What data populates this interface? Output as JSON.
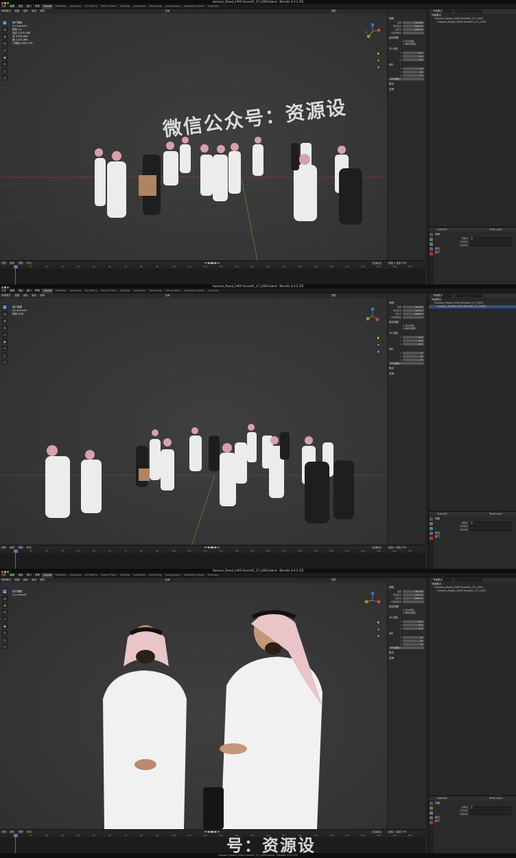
{
  "window": {
    "title_1": "Humans_Posed_2495-Scene01_27_LODS.blend - Blender 4.0.2 LTS",
    "title_2": "Humans_Posed_2495-Scene01_27_LODS.blend - Blender 4.0.2 LTS",
    "title_3": "Humans_Posed_2495-Scene01_27_LODS.blend - Blender 4.0.2 LTS"
  },
  "menubar": {
    "items": [
      "文件",
      "编辑",
      "渲染",
      "窗口",
      "帮助"
    ],
    "workspaces": [
      "Layout",
      "Modeling",
      "Sculpting",
      "UV Editing",
      "Texture Paint",
      "Shading",
      "Animation",
      "Rendering",
      "Compositing",
      "Geometry Nodes",
      "Scripting"
    ]
  },
  "viewport_header": {
    "items": [
      "物体模式",
      "视图",
      "选择",
      "添加",
      "物体"
    ],
    "right_items": [
      "全局",
      "选项"
    ]
  },
  "stats": {
    "lines_1": [
      "用户透视",
      "(1) Scene01",
      "物体  1/1",
      "顶点  2,025,388",
      "边  4,049,568",
      "面  2,025,388",
      "三角面  4,050,776"
    ],
    "lines_2": [
      "用户透视",
      "(1) Scene01",
      "物体  0/28"
    ],
    "lines_3": [
      "用户透视",
      "(1) Scene01"
    ]
  },
  "npanel": {
    "sections": [
      "变换",
      "视图",
      "3D 游标",
      "集合"
    ],
    "fields": [
      {
        "label": "焦距",
        "value": "50 mm"
      },
      {
        "label": "裁剪起点",
        "value": "0.01 m"
      },
      {
        "label": "结束点",
        "value": "1000 m"
      }
    ],
    "local_camera": "局部摄像机",
    "lock_label": "锁定视图",
    "checks": [
      "至3D游标",
      "相机到视图"
    ],
    "cursor_fields": [
      {
        "label": "X",
        "value": "0 m"
      },
      {
        "label": "Y",
        "value": "0 m"
      },
      {
        "label": "Z",
        "value": "0 m"
      }
    ],
    "rotation_label": "旋转",
    "rot_fields": [
      {
        "label": "X",
        "value": "0°"
      },
      {
        "label": "Y",
        "value": "0°"
      },
      {
        "label": "Z",
        "value": "0°"
      }
    ],
    "mode": "XYZ 欧拉"
  },
  "timeline": {
    "items": [
      "回放",
      "键控",
      "视图",
      "标记"
    ],
    "frame": "1",
    "start_end": "起始 1   结束 250",
    "ticks": [
      "0",
      "10",
      "20",
      "30",
      "40",
      "50",
      "60",
      "70",
      "80",
      "90",
      "100",
      "110",
      "120",
      "130",
      "140",
      "150",
      "160",
      "170",
      "180",
      "190",
      "200",
      "210",
      "220",
      "230",
      "240",
      "250"
    ],
    "playhead": "1"
  },
  "outliner": {
    "search": "场景集合",
    "view_layer": "View Layer",
    "rows": [
      "场景集合",
      "Humans_Posed_2495-Scene01_27_LOD3",
      "Humans_Posed_2495-Scene01_27_LOD3"
    ]
  },
  "properties": {
    "scene": "Scene01",
    "view_layer": "View Layer",
    "section": "场景",
    "rows": [
      {
        "label": "摄像机",
        "value": "无"
      },
      {
        "label": "背景场景",
        "value": ""
      },
      {
        "label": "活动剪辑",
        "value": ""
      }
    ],
    "sub_sections": [
      "单位",
      "重力"
    ]
  },
  "watermark": {
    "text_1": "微信公众号：资源设",
    "text_2": "号：资源设"
  },
  "colors": {
    "accent": "#4772b3",
    "axis_red": "#c24a4a",
    "axis_green": "#7ea33a",
    "close": "#ff5f57",
    "min": "#febc2e",
    "max": "#28c840"
  }
}
